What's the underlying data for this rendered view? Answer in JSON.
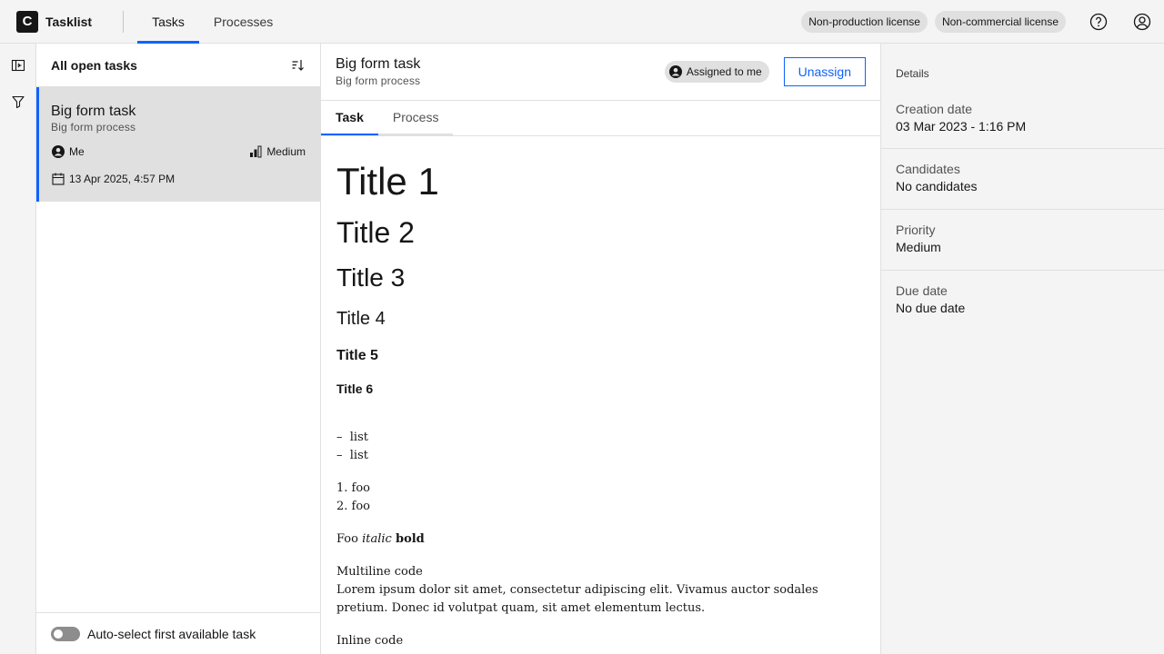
{
  "header": {
    "logo_letter": "C",
    "app_name": "Tasklist",
    "nav": [
      "Tasks",
      "Processes"
    ],
    "tags": [
      "Non-production license",
      "Non-commercial license"
    ]
  },
  "tasklist": {
    "title": "All open tasks",
    "tasks": [
      {
        "name": "Big form task",
        "process": "Big form process",
        "assignee": "Me",
        "priority": "Medium",
        "date": "13 Apr 2025, 4:57 PM"
      }
    ],
    "footer_label": "Auto-select first available task"
  },
  "main": {
    "title": "Big form task",
    "subtitle": "Big form process",
    "assigned_label": "Assigned to me",
    "unassign_label": "Unassign",
    "tabs": [
      "Task",
      "Process"
    ],
    "form": {
      "h1": "Title 1",
      "h2": "Title 2",
      "h3": "Title 3",
      "h4": "Title 4",
      "h5": "Title 5",
      "h6": "Title 6",
      "ul": [
        "list",
        "list"
      ],
      "ol": [
        "foo",
        "foo"
      ],
      "foo_plain": "Foo",
      "foo_italic": "italic",
      "foo_bold": "bold",
      "multiline_label": "Multiline code",
      "multiline_text": "Lorem ipsum dolor sit amet, consectetur adipiscing elit. Vivamus auctor sodales pretium. Donec id volutpat quam, sit amet elementum lectus.",
      "inline_label": "Inline code"
    }
  },
  "details": {
    "title": "Details",
    "sections": [
      {
        "label": "Creation date",
        "value": "03 Mar 2023 - 1:16 PM"
      },
      {
        "label": "Candidates",
        "value": "No candidates"
      },
      {
        "label": "Priority",
        "value": "Medium"
      },
      {
        "label": "Due date",
        "value": "No due date"
      }
    ]
  },
  "colors": {
    "accent": "#0f62fe",
    "selected_bg": "#e0e0e0"
  }
}
